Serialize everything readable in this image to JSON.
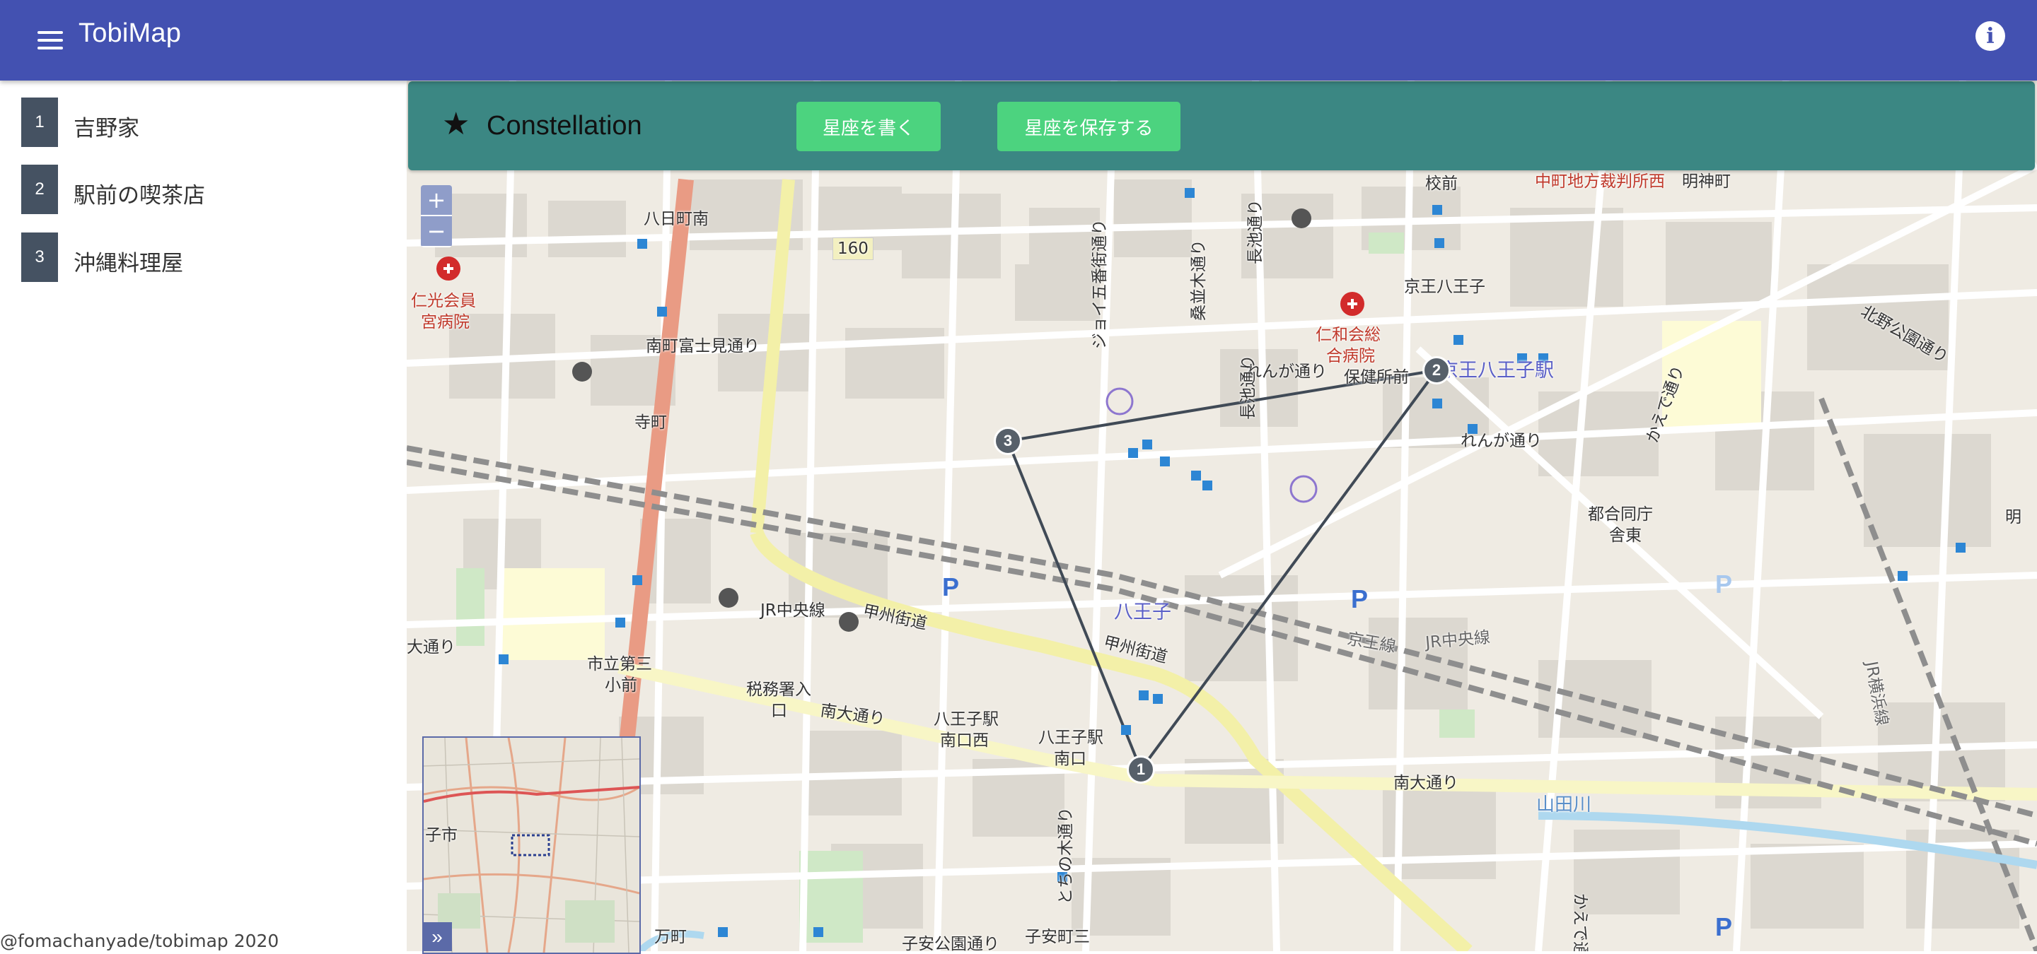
{
  "app": {
    "title": "TobiMap",
    "menu_icon": "hamburger-menu-icon",
    "info_icon": "info-icon",
    "brand_color": "#4351b1"
  },
  "sidebar": {
    "items": [
      {
        "number": "1",
        "label": "吉野家"
      },
      {
        "number": "2",
        "label": "駅前の喫茶店"
      },
      {
        "number": "3",
        "label": "沖縄料理屋"
      }
    ],
    "footer": "@fomachanyade/tobimap 2020"
  },
  "constellation": {
    "icon": "star-icon",
    "title": "Constellation",
    "draw_button": "星座を書く",
    "save_button": "星座を保存する",
    "bar_color": "#3b8783",
    "button_color": "#4cd37f"
  },
  "map": {
    "zoom_in": "+",
    "zoom_out": "−",
    "minimap_toggle": "»",
    "minimap_label": "子市",
    "markers": [
      "1",
      "2",
      "3"
    ],
    "labels": {
      "route160": "160",
      "hachikamachi": "八日町南",
      "jinkoukai": "仁光会員",
      "jinkoukai2": "宮病院",
      "minamimachi": "南町富士見通り",
      "teramachi": "寺町",
      "jr_chuo": "JR中央線",
      "koshu": "甲州街道",
      "nanbu": "南大通り",
      "hachioji_station": "八王子",
      "keio": "京王八王子",
      "keio2": "京王八王子駅",
      "jinwakai": "仁和会総",
      "jinwakai2": "合病院",
      "renga": "れんが通り",
      "renga2": "れんが通り",
      "hokenjo": "保健所前",
      "toto": "都合同庁",
      "toto2": "舎東",
      "shiritsu": "市立第三",
      "shiritsu2": "小前",
      "zeimu": "税務署入",
      "zeimu2": "口",
      "hachioji_s": "八王子駅",
      "hachioji_s2": "南口西",
      "hachioji_sm": "八王子駅",
      "hachioji_sm2": "南口",
      "nanbu2": "南大通り",
      "yamada": "山田川",
      "koyasu": "子安公園通り",
      "koyasu2": "子安町三",
      "manchou": "万町",
      "oodori": "大通り",
      "tochinoki": "とちの木通り",
      "kaede": "かえで通り",
      "kaede2": "かえで通り",
      "kitano": "北野公園通り",
      "akebono": "明神町",
      "saiban": "中町地方裁判所西",
      "kou": "校前",
      "jr_chuo2": "JR中央線",
      "jr_yokohama": "JR横浜線",
      "keio_line": "京王線",
      "koshu2": "甲州街道",
      "kuwanami": "桑並木通り",
      "joi": "ジョイ五番街通り",
      "nagaike": "長池通り",
      "nagaike2": "長池通り",
      "akebono2": "明"
    },
    "line_color": "#404a56",
    "marker_color": "#57606a"
  }
}
